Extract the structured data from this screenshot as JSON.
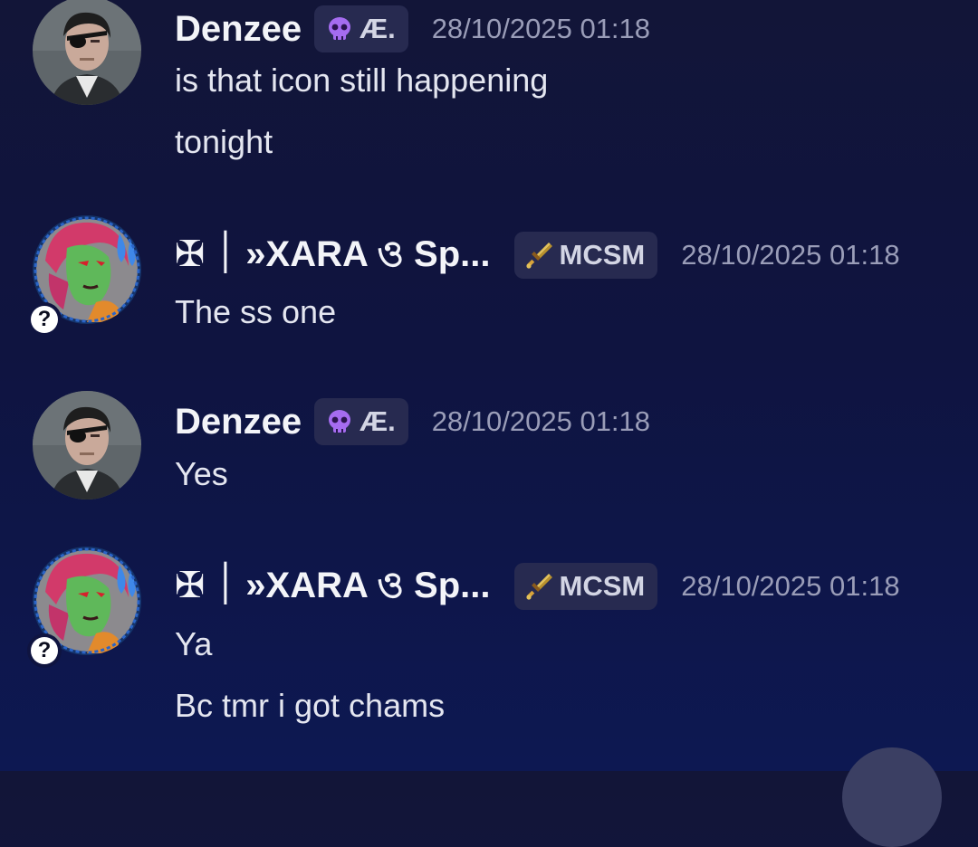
{
  "messages": [
    {
      "username": "Denzee",
      "tag": {
        "icon": "skull-icon",
        "label": "Æ."
      },
      "timestamp": "28/10/2025 01:18",
      "lines": [
        "is that icon still happening",
        "tonight"
      ]
    },
    {
      "username": "✠ ׀ »XARA ও Sp...",
      "tag": {
        "icon": "sword-icon",
        "label": "MCSM"
      },
      "timestamp": "28/10/2025 01:18",
      "badge": "?",
      "lines": [
        "The ss one"
      ]
    },
    {
      "username": "Denzee",
      "tag": {
        "icon": "skull-icon",
        "label": "Æ."
      },
      "timestamp": "28/10/2025 01:18",
      "lines": [
        "Yes"
      ]
    },
    {
      "username": "✠ ׀ »XARA ও Sp...",
      "tag": {
        "icon": "sword-icon",
        "label": "MCSM"
      },
      "timestamp": "28/10/2025 01:18",
      "badge": "?",
      "lines": [
        "Ya",
        "Bc tmr i got chams"
      ]
    }
  ],
  "colors": {
    "background": "#0f1440",
    "tag_background": "#272a50",
    "timestamp": "#9a9db8",
    "skull": "#a56cf0",
    "sword": "#e2c15a"
  }
}
